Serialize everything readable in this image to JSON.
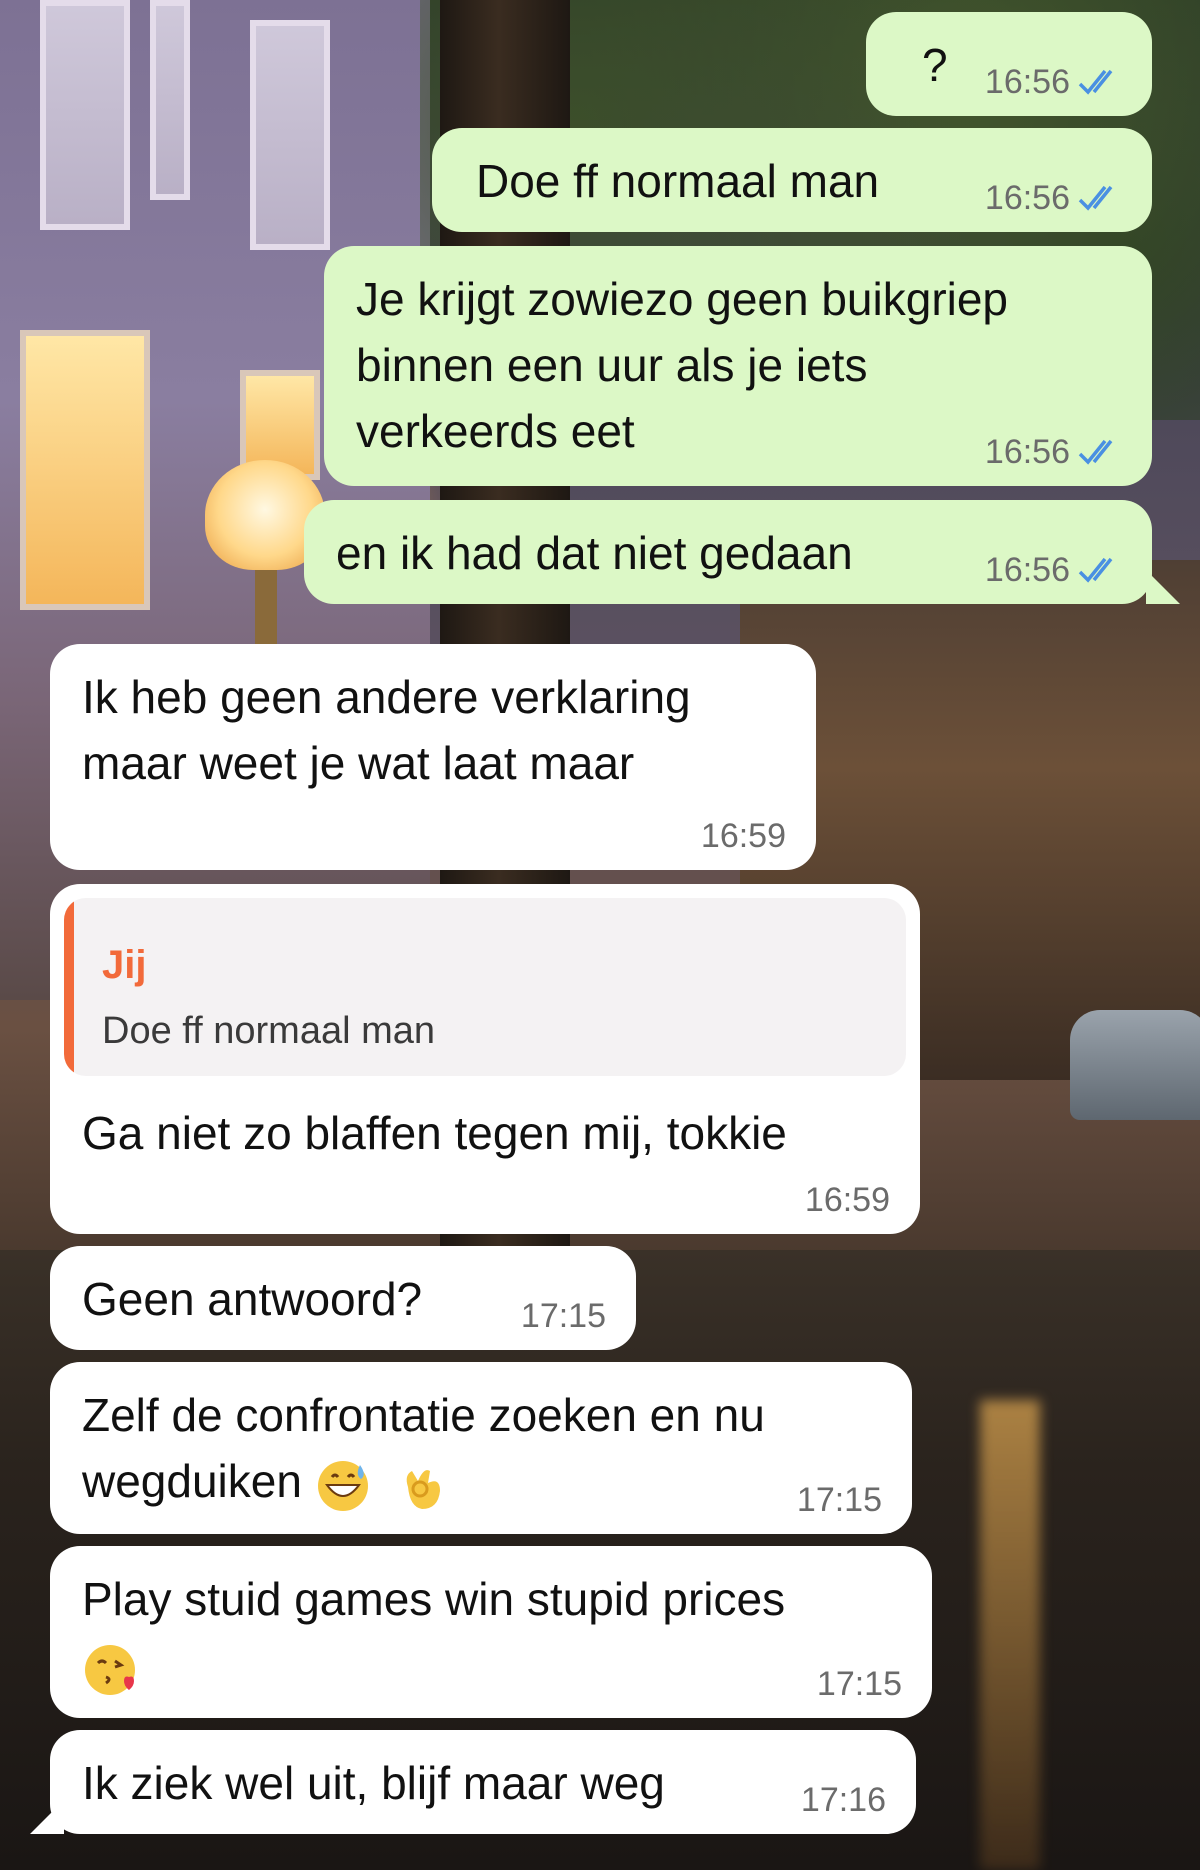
{
  "chat": {
    "messages": [
      {
        "direction": "out",
        "text": "?",
        "time": "16:56",
        "read": true
      },
      {
        "direction": "out",
        "text": "Doe ff normaal man",
        "time": "16:56",
        "read": true
      },
      {
        "direction": "out",
        "text": "Je krijgt zowiezo geen buikgriep\nbinnen een uur als je iets\nverkeerds eet",
        "time": "16:56",
        "read": true
      },
      {
        "direction": "out",
        "text": "en ik had dat niet gedaan",
        "time": "16:56",
        "read": true
      },
      {
        "direction": "in",
        "text": "Ik heb geen andere verklaring\nmaar weet je wat laat maar",
        "time": "16:59"
      },
      {
        "direction": "in",
        "text": "Ga niet zo blaffen tegen mij, tokkie",
        "time": "16:59",
        "reply": {
          "author": "Jij",
          "text": "Doe ff normaal man"
        }
      },
      {
        "direction": "in",
        "text": "Geen antwoord?",
        "time": "17:15"
      },
      {
        "direction": "in",
        "text": "Zelf de confrontatie zoeken en nu\nwegduiken",
        "time": "17:15",
        "emojis": [
          "grinning-sweat-emoji",
          "ok-hand-emoji"
        ]
      },
      {
        "direction": "in",
        "text": "Play stuid games win stupid prices",
        "time": "17:15",
        "emojis": [
          "kissing-heart-emoji"
        ]
      },
      {
        "direction": "in",
        "text": "Ik ziek wel uit, blijf maar weg",
        "time": "17:16"
      }
    ]
  },
  "colors": {
    "outgoing_bubble": "#dcf8c6",
    "incoming_bubble": "#ffffff",
    "read_ticks": "#4a90e2",
    "reply_accent": "#f26a3a"
  }
}
